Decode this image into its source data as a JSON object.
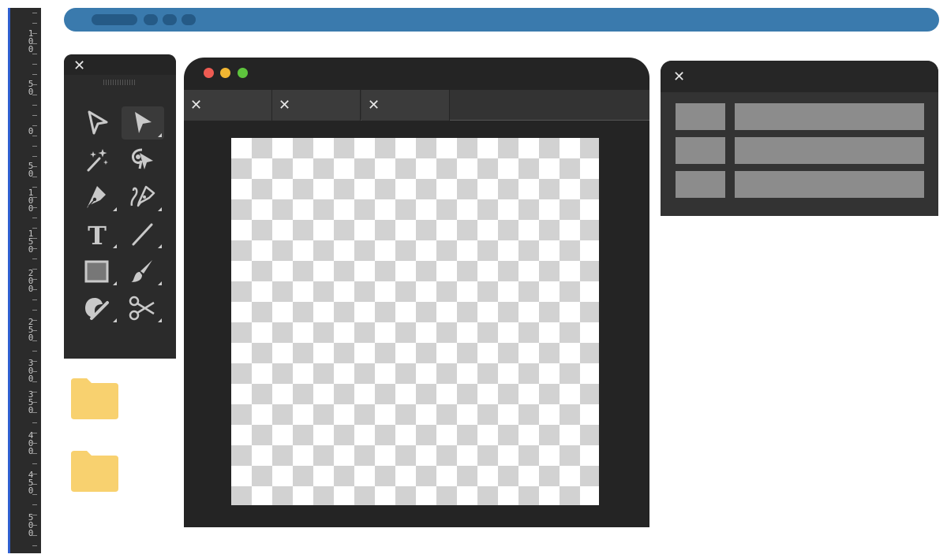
{
  "ruler": {
    "labels": [
      "1\n0\n0",
      "5\n0",
      "0",
      "5\n0",
      "1\n0\n0",
      "1\n5\n0",
      "2\n0\n0",
      "2\n5\n0",
      "3\n0\n0",
      "3\n5\n0",
      "4\n0\n0",
      "4\n5\n0",
      "5\n0\n0"
    ]
  },
  "tools_panel": {
    "close_label": "✕",
    "tools": [
      {
        "name": "direct-selection-tool",
        "icon": "hollow-arrow-icon",
        "active": false,
        "corner": false
      },
      {
        "name": "selection-tool",
        "icon": "solid-arrow-icon",
        "active": true,
        "corner": true
      },
      {
        "name": "magic-wand-tool",
        "icon": "magic-wand-icon",
        "active": false,
        "corner": false
      },
      {
        "name": "lasso-tool",
        "icon": "lasso-icon",
        "active": false,
        "corner": false
      },
      {
        "name": "pen-tool",
        "icon": "pen-nib-icon",
        "active": false,
        "corner": true
      },
      {
        "name": "curvature-pen-tool",
        "icon": "curvature-pen-icon",
        "active": false,
        "corner": true
      },
      {
        "name": "type-tool",
        "icon": "type-icon",
        "text": "T",
        "active": false,
        "corner": true
      },
      {
        "name": "line-tool",
        "icon": "line-icon",
        "active": false,
        "corner": true
      },
      {
        "name": "rectangle-tool",
        "icon": "rectangle-icon",
        "active": false,
        "corner": true
      },
      {
        "name": "paintbrush-tool",
        "icon": "paintbrush-icon",
        "active": false,
        "corner": true
      },
      {
        "name": "shaper-tool",
        "icon": "shaper-icon",
        "active": false,
        "corner": true
      },
      {
        "name": "scissors-tool",
        "icon": "scissors-icon",
        "active": false,
        "corner": true
      }
    ]
  },
  "canvas_window": {
    "traffic_lights": [
      "#ee5b52",
      "#f2b632",
      "#5ec43d"
    ],
    "tabs": [
      {
        "close_label": "✕"
      },
      {
        "close_label": "✕"
      },
      {
        "close_label": "✕"
      }
    ]
  },
  "properties_panel": {
    "close_label": "✕",
    "rows": 3
  },
  "colors": {
    "accent": "#3a7aad",
    "ruler_edge": "#2f5fd0",
    "folder": "#f8d16f",
    "panel": "#2b2b2b",
    "placeholder": "#8c8c8c"
  }
}
